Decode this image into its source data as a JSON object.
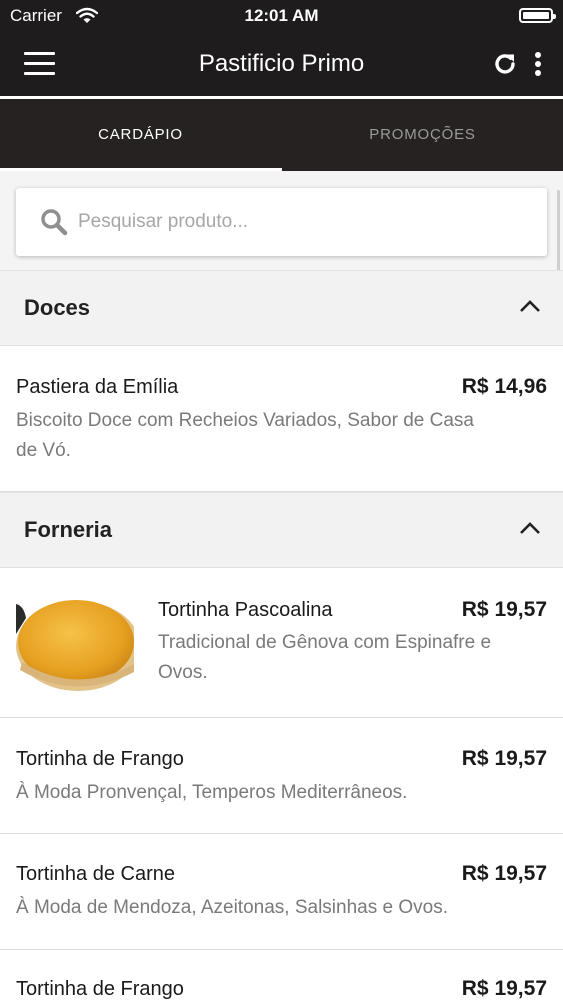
{
  "status_bar": {
    "carrier": "Carrier",
    "time": "12:01 AM"
  },
  "header": {
    "title": "Pastificio Primo"
  },
  "tabs": [
    {
      "label": "CARDÁPIO",
      "active": true
    },
    {
      "label": "PROMOÇÕES",
      "active": false
    }
  ],
  "search": {
    "placeholder": "Pesquisar produto...",
    "value": ""
  },
  "sections": [
    {
      "title": "Doces",
      "items": [
        {
          "name": "Pastiera da Emília",
          "price": "R$ 14,96",
          "desc_lines": [
            "Biscoito Doce com Recheios Variados, Sabor de Casa",
            "de Vó."
          ]
        }
      ]
    },
    {
      "title": "Forneria",
      "items": [
        {
          "name": "Tortinha Pascoalina",
          "price": "R$ 19,57",
          "desc_lines": [
            "Tradicional de Gênova com Espinafre e",
            "Ovos."
          ],
          "has_image": true
        },
        {
          "name": "Tortinha de Frango",
          "price": "R$ 19,57",
          "desc_lines": [
            "À Moda Pronvençal, Temperos Mediterrâneos."
          ]
        },
        {
          "name": "Tortinha de Carne",
          "price": "R$ 19,57",
          "desc_lines": [
            "À Moda de Mendoza, Azeitonas, Salsinhas e Ovos."
          ]
        },
        {
          "name": "Tortinha de Frango",
          "price": "R$ 19,57",
          "desc_lines": []
        }
      ]
    }
  ],
  "colors": {
    "header_bg": "#1e1c1c",
    "tabs_bg": "#252221",
    "section_bg": "#f2f2f2",
    "desc_text": "#7a7a7a"
  }
}
